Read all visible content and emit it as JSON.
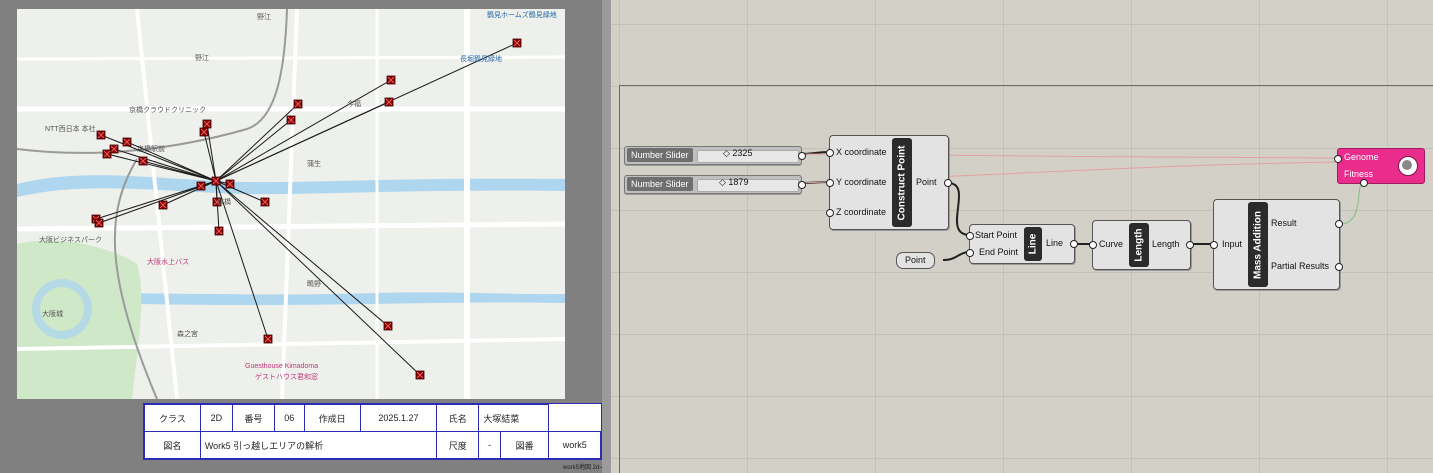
{
  "map": {
    "labels": {
      "station_noe": "野江",
      "tsurumiryokuchi_top": "鶴見ホームズ鶴見緑地",
      "tsurumiryokuchi_line": "長堀鶴見緑地",
      "noe_area": "野江",
      "ntt": "NTT西日本 本社",
      "clinic": "京橋クラウドクリニック",
      "kyobashi_mae": "京橋駅前",
      "osaka_castle_park": "大阪ビジネスパーク",
      "osaka_castle": "大阪城",
      "guesthouse": "Guesthouse Kimadoma",
      "guesthouse_jp": "ゲストハウス君和窓",
      "kyobashi": "京橋",
      "suigen": "大阪水上バス",
      "imafuku": "今福",
      "gamo": "蒲生",
      "shigino": "鴫野",
      "morinomiya": "森之宮"
    },
    "marker_count": 24
  },
  "title_block": {
    "row1": {
      "class_label": "クラス",
      "class_value": "2D",
      "number_label": "番号",
      "number_value": "06",
      "date_label": "作成日",
      "date_value": "2025.1.27",
      "name_label": "氏名",
      "name_value": "大塚結菜"
    },
    "row2": {
      "drawing_label": "図名",
      "drawing_value": "Work5 引っ越しエリアの解析",
      "scale_label": "尺度",
      "scale_value": "-",
      "sheet_label": "図番",
      "sheet_value": "work5"
    }
  },
  "footer_note": "work5地図 2d-o",
  "grasshopper": {
    "slider1": {
      "name": "Number Slider",
      "value": "◇ 2325"
    },
    "slider2": {
      "name": "Number Slider",
      "value": "◇ 1879"
    },
    "construct_point": {
      "title": "Construct Point",
      "inputs": [
        "X coordinate",
        "Y coordinate",
        "Z coordinate"
      ],
      "output": "Point"
    },
    "point_param": "Point",
    "line": {
      "title": "Line",
      "inputs": [
        "Start Point",
        "End Point"
      ],
      "output": "Line"
    },
    "length": {
      "title": "Length",
      "input": "Curve",
      "output": "Length"
    },
    "mass_addition": {
      "title": "Mass Addition",
      "input": "Input",
      "outputs": [
        "Result",
        "Partial Results"
      ]
    },
    "galapagos": {
      "ports": [
        "Genome",
        "Fitness"
      ],
      "icon": "galapagos-icon"
    }
  }
}
